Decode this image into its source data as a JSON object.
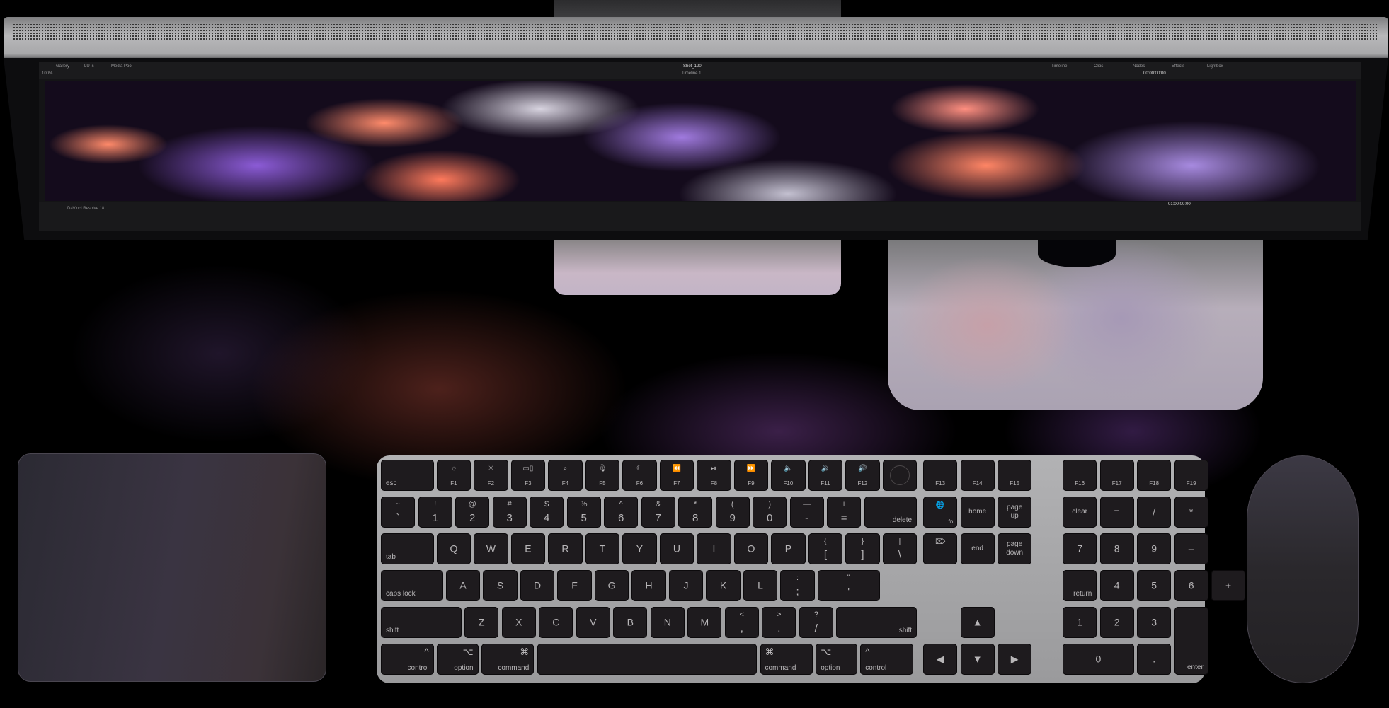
{
  "scene": {
    "description": "Top-down view of Apple Studio Display, Mac Studio, Magic Keyboard with Touch ID and Numeric Keypad, Magic Trackpad and Magic Mouse",
    "colors": {
      "background": "#000000",
      "keycap": "#1e1b1e",
      "keyboard_frame": "#a8a8aa",
      "accent_glow": "#8c3c32"
    }
  },
  "monitor": {
    "app": {
      "header_left": [
        "Gallery",
        "LUTs",
        "Media Pool"
      ],
      "zoom": "100%",
      "title": "Shot_120",
      "timeline": "Timeline 1",
      "header_right": [
        "Timeline",
        "Clips",
        "Nodes",
        "Effects",
        "Lightbox"
      ],
      "timecode_top": "00:00:00:00",
      "timecode_bottom": "01:00:00:00",
      "footer_app_name": "DaVinci Resolve 18"
    }
  },
  "keyboard": {
    "rows": [
      [
        {
          "label": "esc",
          "type": "mod-left"
        },
        {
          "label": "F1",
          "icon": "☼"
        },
        {
          "label": "F2",
          "icon": "☀"
        },
        {
          "label": "F3",
          "icon": "▭▯"
        },
        {
          "label": "F4",
          "icon": "⌕"
        },
        {
          "label": "F5",
          "icon": "🎙"
        },
        {
          "label": "F6",
          "icon": "☾"
        },
        {
          "label": "F7",
          "icon": "⏪"
        },
        {
          "label": "F8",
          "icon": "⏯"
        },
        {
          "label": "F9",
          "icon": "⏩"
        },
        {
          "label": "F10",
          "icon": "🔈"
        },
        {
          "label": "F11",
          "icon": "🔉"
        },
        {
          "label": "F12",
          "icon": "🔊"
        },
        {
          "label": "",
          "type": "touch-id"
        },
        {
          "label": "F13"
        },
        {
          "label": "F14"
        },
        {
          "label": "F15"
        },
        {
          "label": "F16"
        },
        {
          "label": "F17"
        },
        {
          "label": "F18"
        },
        {
          "label": "F19"
        }
      ],
      [
        {
          "top": "~",
          "bottom": "`"
        },
        {
          "top": "!",
          "bottom": "1"
        },
        {
          "top": "@",
          "bottom": "2"
        },
        {
          "top": "#",
          "bottom": "3"
        },
        {
          "top": "$",
          "bottom": "4"
        },
        {
          "top": "%",
          "bottom": "5"
        },
        {
          "top": "^",
          "bottom": "6"
        },
        {
          "top": "&",
          "bottom": "7"
        },
        {
          "top": "*",
          "bottom": "8"
        },
        {
          "top": "(",
          "bottom": "9"
        },
        {
          "top": ")",
          "bottom": "0"
        },
        {
          "top": "—",
          "bottom": "-"
        },
        {
          "top": "+",
          "bottom": "="
        },
        {
          "label": "delete",
          "type": "mod-right"
        },
        {
          "label": "fn",
          "icon": "🌐"
        },
        {
          "label": "home"
        },
        {
          "label": "page up"
        },
        {
          "label": "clear"
        },
        {
          "label": "="
        },
        {
          "label": "/"
        },
        {
          "label": "*"
        }
      ],
      [
        {
          "label": "tab",
          "type": "mod-left"
        },
        {
          "label": "Q"
        },
        {
          "label": "W"
        },
        {
          "label": "E"
        },
        {
          "label": "R"
        },
        {
          "label": "T"
        },
        {
          "label": "Y"
        },
        {
          "label": "U"
        },
        {
          "label": "I"
        },
        {
          "label": "O"
        },
        {
          "label": "P"
        },
        {
          "top": "{",
          "bottom": "["
        },
        {
          "top": "}",
          "bottom": "]"
        },
        {
          "top": "|",
          "bottom": "\\"
        },
        {
          "label": "",
          "icon": "⌦"
        },
        {
          "label": "end"
        },
        {
          "label": "page down"
        },
        {
          "label": "7"
        },
        {
          "label": "8"
        },
        {
          "label": "9"
        },
        {
          "label": "–"
        }
      ],
      [
        {
          "label": "caps lock",
          "type": "mod-left"
        },
        {
          "label": "A"
        },
        {
          "label": "S"
        },
        {
          "label": "D"
        },
        {
          "label": "F"
        },
        {
          "label": "G"
        },
        {
          "label": "H"
        },
        {
          "label": "J"
        },
        {
          "label": "K"
        },
        {
          "label": "L"
        },
        {
          "top": ":",
          "bottom": ";"
        },
        {
          "top": "\"",
          "bottom": "'"
        },
        {
          "label": "return",
          "type": "mod-right"
        },
        {
          "label": "4"
        },
        {
          "label": "5"
        },
        {
          "label": "6"
        },
        {
          "label": "+"
        }
      ],
      [
        {
          "label": "shift",
          "type": "mod-left"
        },
        {
          "label": "Z"
        },
        {
          "label": "X"
        },
        {
          "label": "C"
        },
        {
          "label": "V"
        },
        {
          "label": "B"
        },
        {
          "label": "N"
        },
        {
          "label": "M"
        },
        {
          "top": "<",
          "bottom": ","
        },
        {
          "top": ">",
          "bottom": "."
        },
        {
          "top": "?",
          "bottom": "/"
        },
        {
          "label": "shift",
          "type": "mod-right"
        },
        {
          "label": "▲"
        },
        {
          "label": "1"
        },
        {
          "label": "2"
        },
        {
          "label": "3"
        },
        {
          "label": "enter",
          "type": "mod-right"
        }
      ],
      [
        {
          "label": "control",
          "symbol": "^",
          "type": "mod-right"
        },
        {
          "label": "option",
          "symbol": "⌥",
          "type": "mod-right"
        },
        {
          "label": "command",
          "symbol": "⌘",
          "type": "mod-right"
        },
        {
          "label": "",
          "type": "space"
        },
        {
          "label": "command",
          "symbol": "⌘",
          "type": "mod-left"
        },
        {
          "label": "option",
          "symbol": "⌥",
          "type": "mod-left"
        },
        {
          "label": "control",
          "symbol": "^",
          "type": "mod-left"
        },
        {
          "label": "◀"
        },
        {
          "label": "▼"
        },
        {
          "label": "▶"
        },
        {
          "label": "0"
        },
        {
          "label": "."
        }
      ]
    ]
  },
  "mouse": {
    "logo": ""
  },
  "studio": {
    "logo": "apple-logo"
  }
}
